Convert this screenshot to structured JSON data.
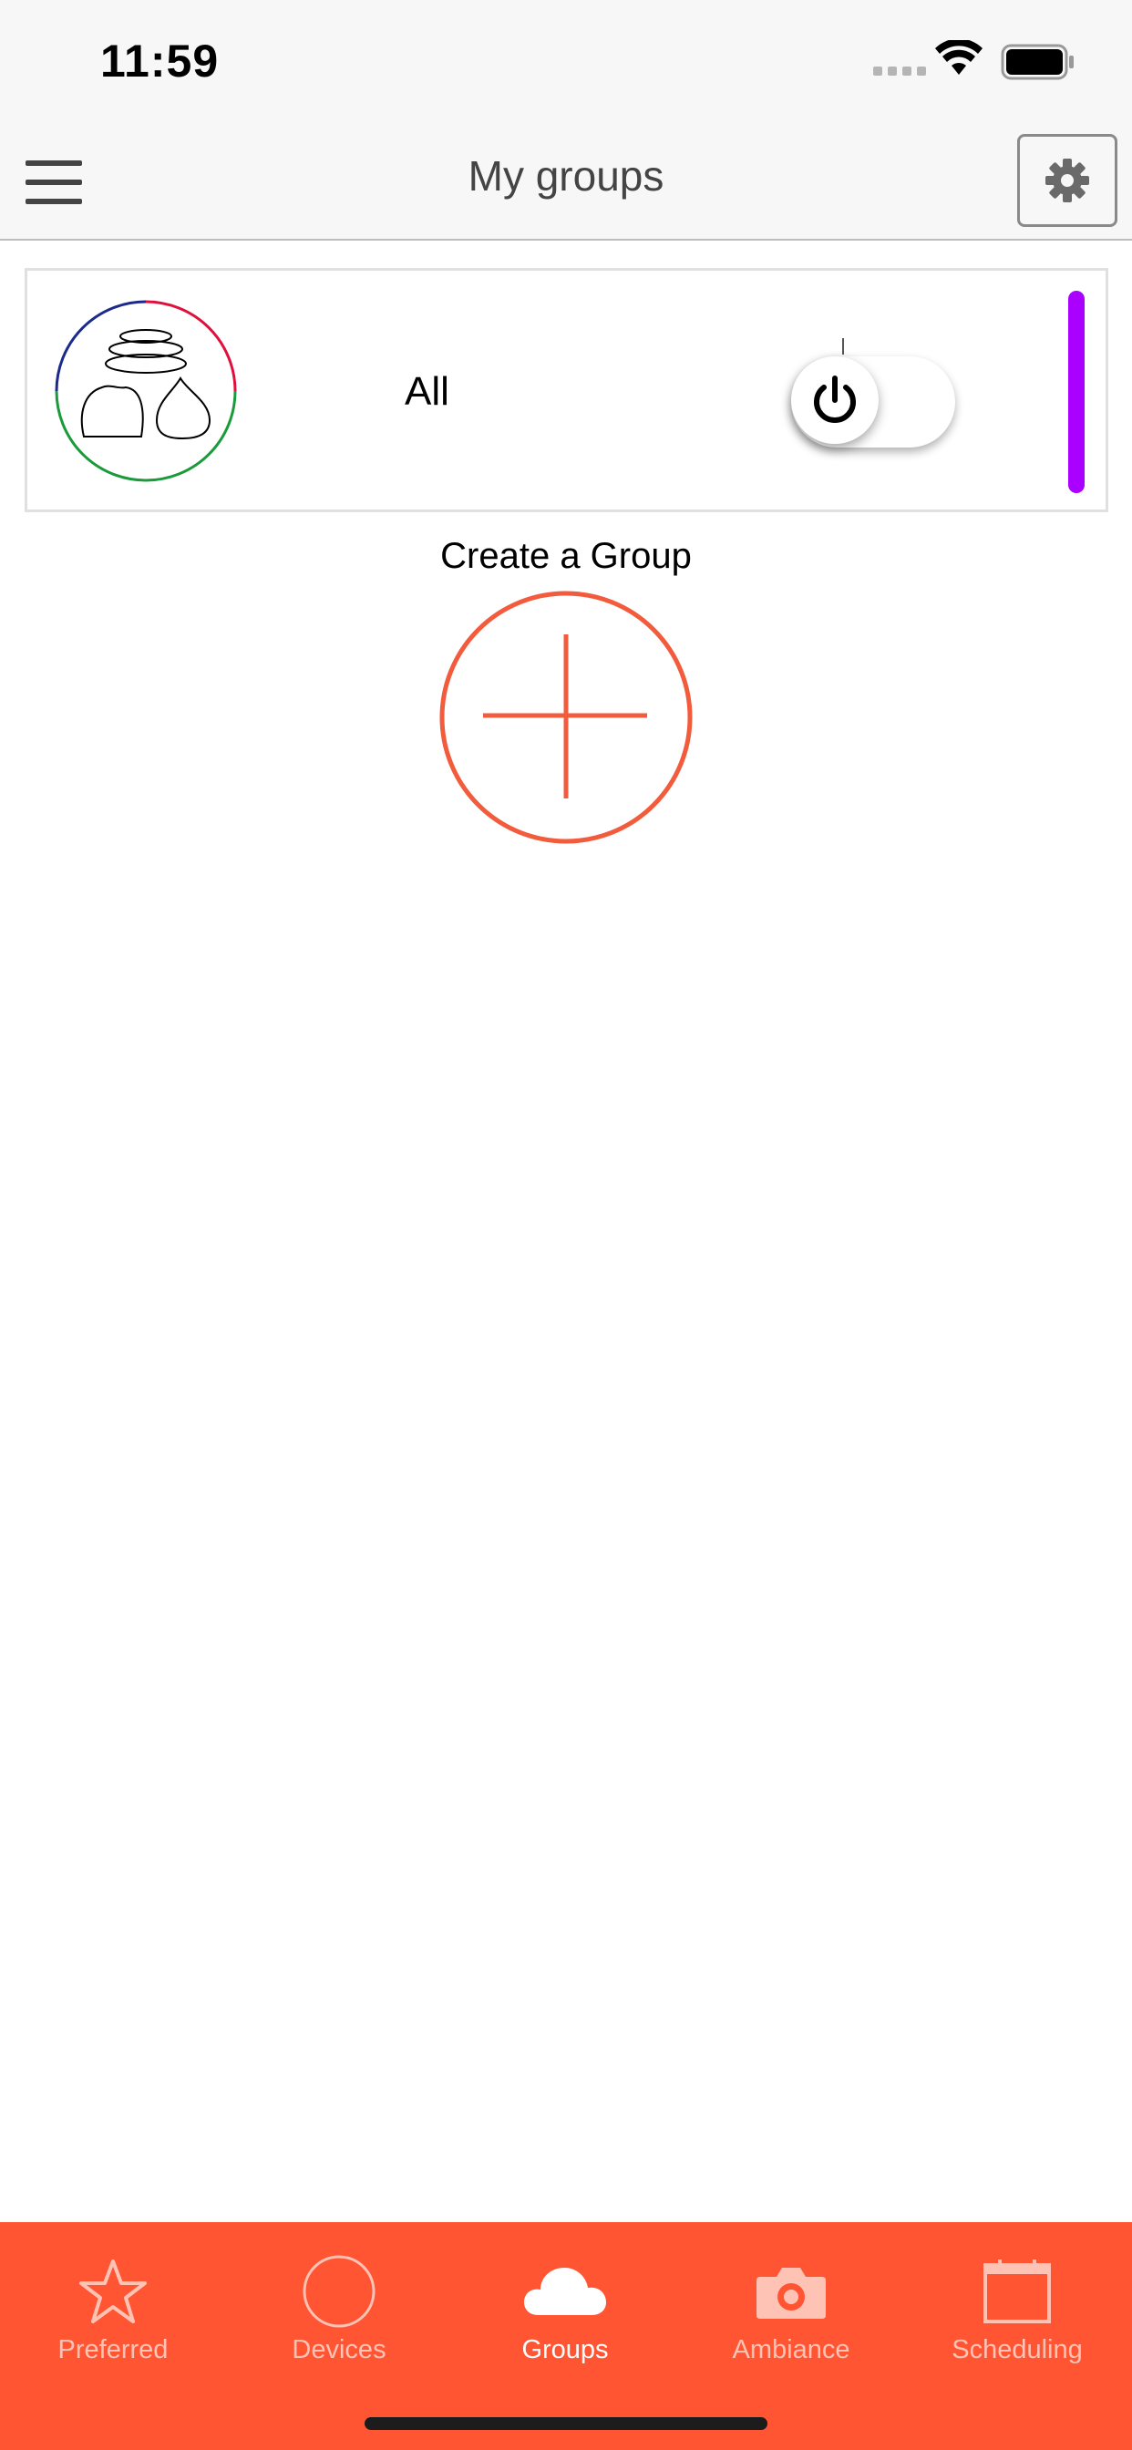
{
  "status_bar": {
    "time": "11:59"
  },
  "nav": {
    "title": "My groups"
  },
  "group": {
    "name": "All",
    "accent_color": "#aa00ff",
    "toggle_state": "off"
  },
  "create": {
    "label": "Create a Group"
  },
  "tabs": [
    {
      "label": "Preferred",
      "icon": "star-icon",
      "active": false
    },
    {
      "label": "Devices",
      "icon": "circle-icon",
      "active": false
    },
    {
      "label": "Groups",
      "icon": "cloud-icon",
      "active": true
    },
    {
      "label": "Ambiance",
      "icon": "camera-icon",
      "active": false
    },
    {
      "label": "Scheduling",
      "icon": "calendar-icon",
      "active": false
    }
  ],
  "colors": {
    "brand": "#ff5533",
    "tab_bar": "#ff5533",
    "tab_inactive": "#ffc3b5",
    "tab_active": "#ffffff",
    "nav_background": "#f7f7f7"
  }
}
